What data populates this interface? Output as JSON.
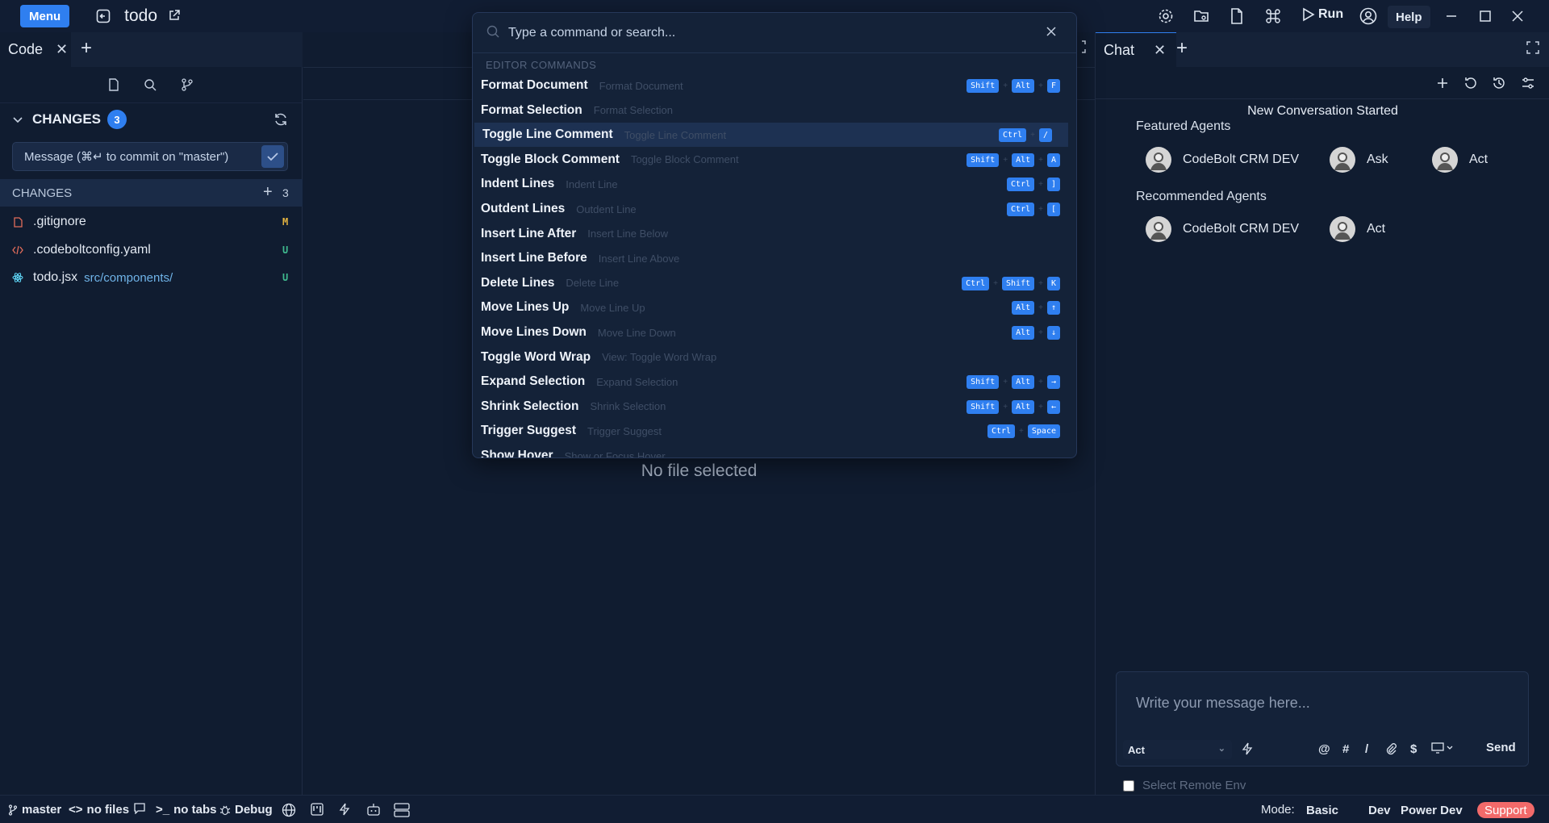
{
  "topbar": {
    "menu_label": "Menu",
    "project_title": "todo",
    "run_label": "Run",
    "help_label": "Help"
  },
  "left_tabs": {
    "code_tab_label": "Code"
  },
  "sidebar": {
    "changes_title": "CHANGES",
    "changes_count": "3",
    "commit_placeholder": "Message (⌘↵ to commit on \"master\")",
    "changes_sub_title": "CHANGES",
    "changes_sub_count": "3",
    "files": [
      {
        "name": ".gitignore",
        "path": "",
        "status": "M",
        "status_color": "#e3b341",
        "icon": "file-icon",
        "icon_color": "#e06c5a"
      },
      {
        "name": ".codeboltconfig.yaml",
        "path": "",
        "status": "U",
        "status_color": "#3fb98e",
        "icon": "code-icon",
        "icon_color": "#e06c5a"
      },
      {
        "name": "todo.jsx",
        "path": "src/components/",
        "status": "U",
        "status_color": "#3fb98e",
        "icon": "react-icon",
        "icon_color": "#61dafb"
      }
    ]
  },
  "editor": {
    "empty_text": "No file selected"
  },
  "chat": {
    "tab_label": "Chat",
    "conversation_started": "New Conversation Started",
    "featured_title": "Featured Agents",
    "featured_agents": [
      "CodeBolt CRM DEV",
      "Ask",
      "Act"
    ],
    "recommended_title": "Recommended Agents",
    "recommended_agents": [
      "CodeBolt CRM DEV",
      "Act"
    ],
    "input_placeholder": "Write your message here...",
    "mode_value": "Act",
    "send_label": "Send",
    "remote_env_label": "Select Remote Env",
    "input_icons": [
      "@",
      "#",
      "/",
      "$"
    ]
  },
  "palette": {
    "placeholder": "Type a command or search...",
    "section": "EDITOR COMMANDS",
    "commands": [
      {
        "name": "Format Document",
        "desc": "Format Document",
        "keys": [
          "Shift",
          "Alt",
          "F"
        ]
      },
      {
        "name": "Format Selection",
        "desc": "Format Selection",
        "keys": []
      },
      {
        "name": "Toggle Line Comment",
        "desc": "Toggle Line Comment",
        "keys": [
          "Ctrl",
          "/"
        ],
        "selected": true
      },
      {
        "name": "Toggle Block Comment",
        "desc": "Toggle Block Comment",
        "keys": [
          "Shift",
          "Alt",
          "A"
        ]
      },
      {
        "name": "Indent Lines",
        "desc": "Indent Line",
        "keys": [
          "Ctrl",
          "]"
        ]
      },
      {
        "name": "Outdent Lines",
        "desc": "Outdent Line",
        "keys": [
          "Ctrl",
          "["
        ]
      },
      {
        "name": "Insert Line After",
        "desc": "Insert Line Below",
        "keys": []
      },
      {
        "name": "Insert Line Before",
        "desc": "Insert Line Above",
        "keys": []
      },
      {
        "name": "Delete Lines",
        "desc": "Delete Line",
        "keys": [
          "Ctrl",
          "Shift",
          "K"
        ]
      },
      {
        "name": "Move Lines Up",
        "desc": "Move Line Up",
        "keys": [
          "Alt",
          "↑"
        ]
      },
      {
        "name": "Move Lines Down",
        "desc": "Move Line Down",
        "keys": [
          "Alt",
          "↓"
        ]
      },
      {
        "name": "Toggle Word Wrap",
        "desc": "View: Toggle Word Wrap",
        "keys": []
      },
      {
        "name": "Expand Selection",
        "desc": "Expand Selection",
        "keys": [
          "Shift",
          "Alt",
          "→"
        ]
      },
      {
        "name": "Shrink Selection",
        "desc": "Shrink Selection",
        "keys": [
          "Shift",
          "Alt",
          "←"
        ]
      },
      {
        "name": "Trigger Suggest",
        "desc": "Trigger Suggest",
        "keys": [
          "Ctrl",
          "Space"
        ]
      },
      {
        "name": "Show Hover",
        "desc": "Show or Focus Hover",
        "keys": []
      }
    ]
  },
  "statusbar": {
    "branch": "master",
    "files": "no files",
    "tabs": "no tabs",
    "debug": "Debug",
    "mode_label": "Mode:",
    "modes": [
      "Basic",
      "Dev",
      "Power Dev"
    ],
    "support_label": "Support"
  },
  "colors": {
    "accent": "#2f7ff0",
    "support": "#f26a6a",
    "background": "#101c30"
  }
}
